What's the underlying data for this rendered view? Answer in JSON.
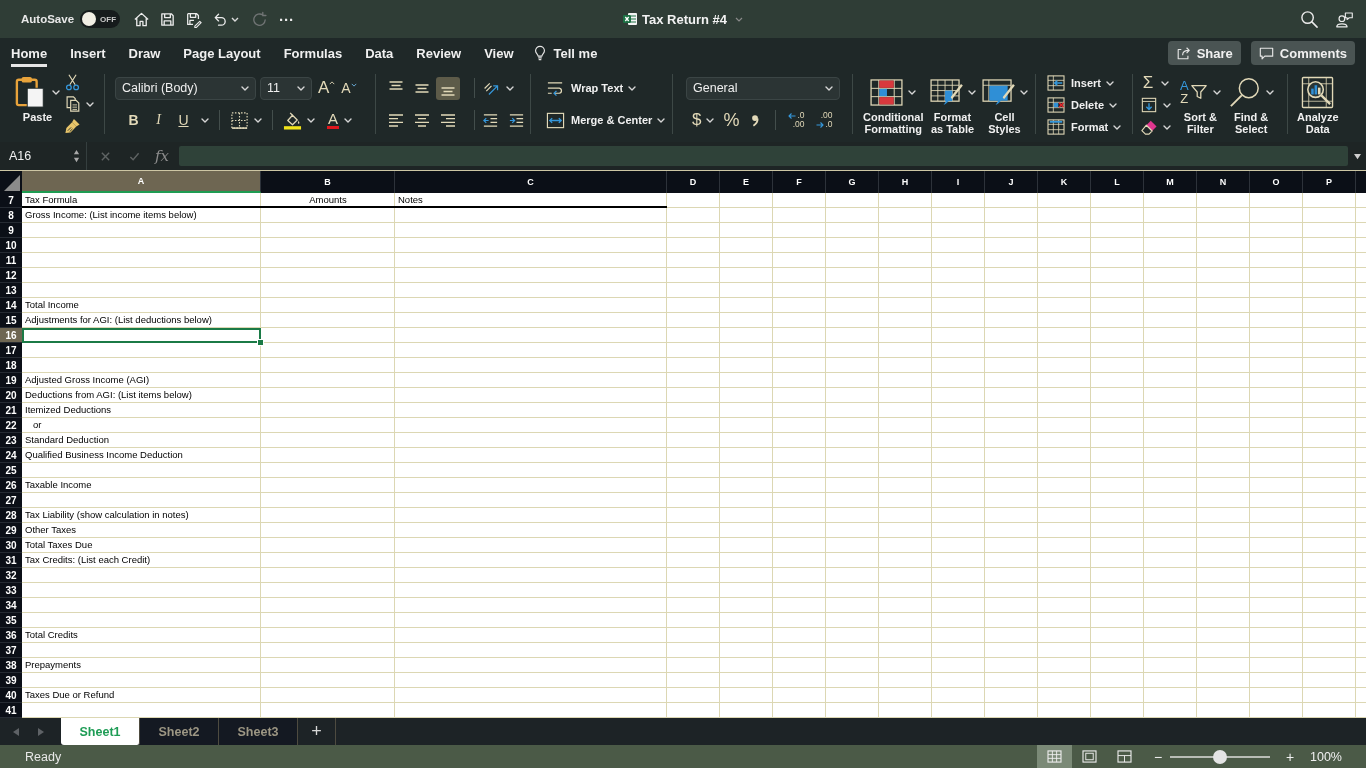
{
  "title_bar": {
    "autosave": {
      "label": "AutoSave",
      "on": false,
      "state_text": "OFF"
    },
    "more": "···",
    "title": "Tax Return #4"
  },
  "menu_tabs": [
    {
      "label": "Home",
      "selected": true
    },
    {
      "label": "Insert",
      "selected": false
    },
    {
      "label": "Draw",
      "selected": false
    },
    {
      "label": "Page Layout",
      "selected": false
    },
    {
      "label": "Formulas",
      "selected": false
    },
    {
      "label": "Data",
      "selected": false
    },
    {
      "label": "Review",
      "selected": false
    },
    {
      "label": "View",
      "selected": false
    }
  ],
  "tell_me": "Tell me",
  "share": "Share",
  "comments": "Comments",
  "ribbon": {
    "paste": "Paste",
    "font": {
      "name": "Calibri (Body)",
      "size": "11",
      "grow": "A",
      "shrink": "A",
      "bold": "B",
      "italic": "I",
      "underline": "U",
      "font_color": "A"
    },
    "vertical_align": [
      {
        "kind": "top",
        "selected": false
      },
      {
        "kind": "middle",
        "selected": false
      },
      {
        "kind": "bottom",
        "selected": true
      }
    ],
    "horizontal_align": [
      {
        "kind": "left",
        "selected": false
      },
      {
        "kind": "center",
        "selected": false
      },
      {
        "kind": "right",
        "selected": false
      }
    ],
    "wrap_text": "Wrap Text",
    "merge": "Merge & Center",
    "number": {
      "format": "General",
      "currency": "$",
      "percent": "%",
      "decimals": [
        {
          "kind": "increase",
          "top": ".0",
          "bottom": ".00"
        },
        {
          "kind": "decrease",
          "top": ".00",
          "bottom": ".0"
        }
      ]
    },
    "styles": [
      {
        "kind": "conditional",
        "label": "Conditional\nFormatting"
      },
      {
        "kind": "table",
        "label": "Format\nas Table"
      },
      {
        "kind": "cell",
        "label": "Cell\nStyles"
      }
    ],
    "cells": [
      {
        "kind": "insert",
        "label": "Insert"
      },
      {
        "kind": "delete",
        "label": "Delete"
      },
      {
        "kind": "format",
        "label": "Format"
      }
    ],
    "autosum": "Σ",
    "sort": {
      "letters": [
        "A",
        "Z"
      ],
      "label": "Sort &\nFilter"
    },
    "find": "Find &\nSelect",
    "analyze": "Analyze\nData"
  },
  "formula_bar": {
    "name_box": "A16",
    "fx": "fx"
  },
  "sheet": {
    "columns": [
      {
        "label": "A",
        "selected": true
      },
      {
        "label": "B",
        "selected": false
      },
      {
        "label": "C",
        "selected": false
      },
      {
        "label": "D",
        "selected": false
      },
      {
        "label": "E",
        "selected": false
      },
      {
        "label": "F",
        "selected": false
      },
      {
        "label": "G",
        "selected": false
      },
      {
        "label": "H",
        "selected": false
      },
      {
        "label": "I",
        "selected": false
      },
      {
        "label": "J",
        "selected": false
      },
      {
        "label": "K",
        "selected": false
      },
      {
        "label": "L",
        "selected": false
      },
      {
        "label": "M",
        "selected": false
      },
      {
        "label": "N",
        "selected": false
      },
      {
        "label": "O",
        "selected": false
      },
      {
        "label": "P",
        "selected": false
      }
    ],
    "rows": [
      {
        "number": "7",
        "kind": "header",
        "selected": false,
        "cells": [
          "Tax Formula",
          "Amounts",
          "Notes"
        ]
      },
      {
        "number": "8",
        "kind": "data",
        "selected": false,
        "cells": [
          "Gross Income: (List income items below)"
        ]
      },
      {
        "number": "9",
        "kind": "data",
        "selected": false
      },
      {
        "number": "10",
        "kind": "data",
        "selected": false
      },
      {
        "number": "11",
        "kind": "data",
        "selected": false
      },
      {
        "number": "12",
        "kind": "data",
        "selected": false
      },
      {
        "number": "13",
        "kind": "data",
        "selected": false
      },
      {
        "number": "14",
        "kind": "data",
        "selected": false,
        "cells": [
          "Total Income"
        ]
      },
      {
        "number": "15",
        "kind": "data",
        "selected": false,
        "cells": [
          "Adjustments for AGI: (List deductions below)"
        ]
      },
      {
        "number": "16",
        "kind": "data",
        "selected": true
      },
      {
        "number": "17",
        "kind": "data",
        "selected": false
      },
      {
        "number": "18",
        "kind": "data",
        "selected": false
      },
      {
        "number": "19",
        "kind": "data",
        "selected": false,
        "cells": [
          "Adjusted Gross Income (AGI)"
        ]
      },
      {
        "number": "20",
        "kind": "data",
        "selected": false,
        "cells": [
          "Deductions from AGI: (List items below)"
        ]
      },
      {
        "number": "21",
        "kind": "data",
        "selected": false,
        "cells": [
          "Itemized Deductions"
        ]
      },
      {
        "number": "22",
        "kind": "data",
        "selected": false,
        "cells": [
          "   or"
        ]
      },
      {
        "number": "23",
        "kind": "data",
        "selected": false,
        "cells": [
          "Standard Deduction"
        ]
      },
      {
        "number": "24",
        "kind": "data",
        "selected": false,
        "cells": [
          "Qualified Business Income Deduction"
        ]
      },
      {
        "number": "25",
        "kind": "data",
        "selected": false
      },
      {
        "number": "26",
        "kind": "data",
        "selected": false,
        "cells": [
          "Taxable Income"
        ]
      },
      {
        "number": "27",
        "kind": "data",
        "selected": false
      },
      {
        "number": "28",
        "kind": "data",
        "selected": false,
        "cells": [
          "Tax Liability (show calculation in notes)"
        ]
      },
      {
        "number": "29",
        "kind": "data",
        "selected": false,
        "cells": [
          "Other Taxes"
        ]
      },
      {
        "number": "30",
        "kind": "data",
        "selected": false,
        "cells": [
          "Total Taxes Due"
        ]
      },
      {
        "number": "31",
        "kind": "data",
        "selected": false,
        "cells": [
          "Tax Credits: (List each Credit)"
        ]
      },
      {
        "number": "32",
        "kind": "data",
        "selected": false
      },
      {
        "number": "33",
        "kind": "data",
        "selected": false
      },
      {
        "number": "34",
        "kind": "data",
        "selected": false
      },
      {
        "number": "35",
        "kind": "data",
        "selected": false
      },
      {
        "number": "36",
        "kind": "data",
        "selected": false,
        "cells": [
          "Total Credits"
        ]
      },
      {
        "number": "37",
        "kind": "data",
        "selected": false
      },
      {
        "number": "38",
        "kind": "data",
        "selected": false,
        "cells": [
          "Prepayments"
        ]
      },
      {
        "number": "39",
        "kind": "data",
        "selected": false
      },
      {
        "number": "40",
        "kind": "data",
        "selected": false,
        "cells": [
          "Taxes Due or Refund"
        ]
      },
      {
        "number": "41",
        "kind": "data",
        "selected": false
      }
    ]
  },
  "sheet_tabs": [
    {
      "label": "Sheet1",
      "selected": true
    },
    {
      "label": "Sheet2",
      "selected": false
    },
    {
      "label": "Sheet3",
      "selected": false
    }
  ],
  "add_sheet": "+",
  "status_bar": {
    "status": "Ready",
    "views": [
      {
        "kind": "normal",
        "selected": true
      },
      {
        "kind": "page_layout",
        "selected": false
      },
      {
        "kind": "page_break",
        "selected": false
      }
    ],
    "zoom_out": "−",
    "zoom_in": "+",
    "zoom": {
      "level": 0.5,
      "label": "100%"
    }
  }
}
